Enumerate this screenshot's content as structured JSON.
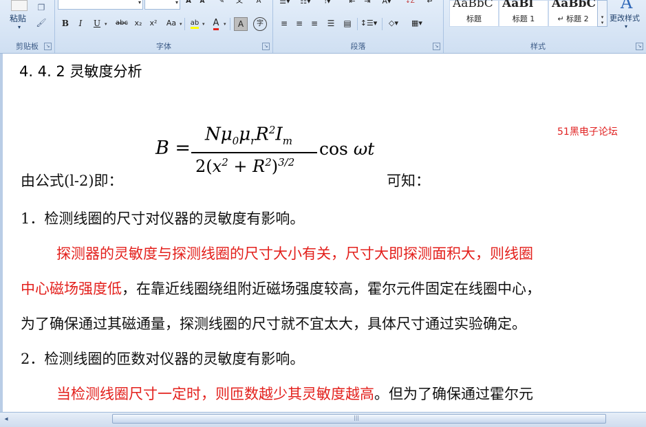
{
  "ribbon": {
    "clipboard": {
      "paste_label": "粘贴",
      "group_label": "剪贴板"
    },
    "font": {
      "group_label": "字体",
      "grow_label": "A",
      "shrink_label": "A",
      "bold": "B",
      "italic": "I",
      "underline": "U",
      "strikethrough": "abc",
      "subscript": "x₂",
      "superscript": "x²",
      "change_case": "Aa",
      "highlight": "ab",
      "font_color": "A",
      "char_shading": "A",
      "enclose": "字"
    },
    "paragraph": {
      "group_label": "段落"
    },
    "styles": {
      "group_label": "样式",
      "items": [
        {
          "sample": "AaBbC",
          "name": "标题"
        },
        {
          "sample": "AaBl",
          "name": "标题 1"
        },
        {
          "sample": "AaBbC",
          "name": "↵ 标题 2"
        }
      ],
      "change_styles_label": "更改样式"
    }
  },
  "document": {
    "heading": "4. 4. 2 灵敏度分析",
    "watermark": "51黑电子论坛",
    "formula_intro": "由公式(l-2)即：",
    "formula_outro": "可知：",
    "formula": {
      "lhs": "B =",
      "numerator": "Nμ0μrR2Im",
      "denominator": "2(x2 + R2)3/2",
      "tail": "cos ωt"
    },
    "item1": "1．检测线圈的尺寸对仪器的灵敏度有影响。",
    "p1_red_a": "探测器的灵敏度与探测线圈的尺寸大小有关，尺寸大即探测面积大，则线圈",
    "p1_red_b": "中心磁场强度低",
    "p1_black_b": "，在靠近线圈绕组附近磁场强度较高，霍尔元件固定在线圈中心，",
    "p1_line3": "为了确保通过其磁通量，探测线圈的尺寸就不宜太大，具体尺寸通过实验确定。",
    "item2": "2．检测线圈的匝数对仪器的灵敏度有影响。",
    "p2_red": "当检测线圈尺寸一定时，则匝数越少其灵敏度越高",
    "p2_black": "。但为了确保通过霍尔元"
  },
  "colors": {
    "red_text": "#e3201c",
    "ribbon_bg": "#dbe7f5"
  }
}
